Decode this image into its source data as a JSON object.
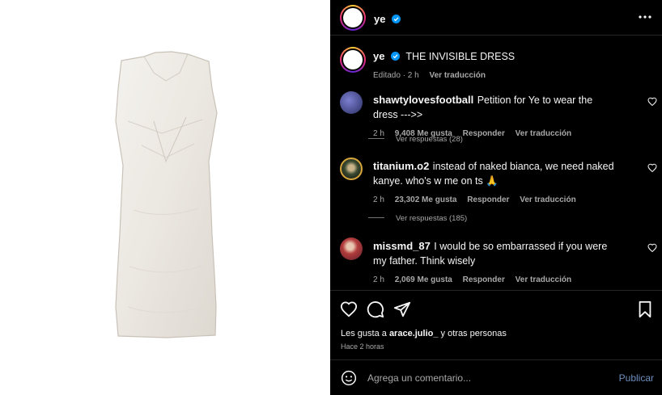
{
  "post": {
    "username": "ye",
    "caption_username": "ye",
    "caption_text": "THE INVISIBLE DRESS",
    "caption_edited": "Editado · 2 h",
    "caption_translate": "Ver traducción"
  },
  "comments": [
    {
      "username": "shawtylovesfootball",
      "text": "Petition for Ye to wear the dress --->>",
      "time": "2 h",
      "likes": "9,408 Me gusta",
      "reply": "Responder",
      "translate": "Ver traducción",
      "view_replies": "Ver respuestas (28)",
      "avatar_color": "#3b3f7a"
    },
    {
      "username": "titanium.o2",
      "text": "instead of naked bianca, we need naked kanye. who's w me on ts 🙏",
      "time": "2 h",
      "likes": "23,302 Me gusta",
      "reply": "Responder",
      "translate": "Ver traducción",
      "view_replies": "Ver respuestas (185)",
      "avatar_color": "#2e3b2a"
    },
    {
      "username": "missmd_87",
      "text": "I would be so embarrassed if you were my father. Think wisely",
      "time": "2 h",
      "likes": "2,069 Me gusta",
      "reply": "Responder",
      "translate": "Ver traducción",
      "avatar_color": "#a33a3a"
    }
  ],
  "actions": {
    "likes_prefix": "Les gusta a",
    "likes_user": "arace.julio_",
    "likes_suffix": "y otras personas",
    "posted": "Hace 2 horas"
  },
  "composer": {
    "placeholder": "Agrega un comentario...",
    "publish": "Publicar"
  },
  "colors": {
    "accent": "#0095f6",
    "verified": "#0095f6",
    "background": "#000000",
    "muted": "#a8a8a8"
  },
  "icons": [
    "more-icon",
    "verified-icon",
    "heart-icon",
    "comment-icon",
    "share-icon",
    "bookmark-icon",
    "emoji-icon"
  ]
}
